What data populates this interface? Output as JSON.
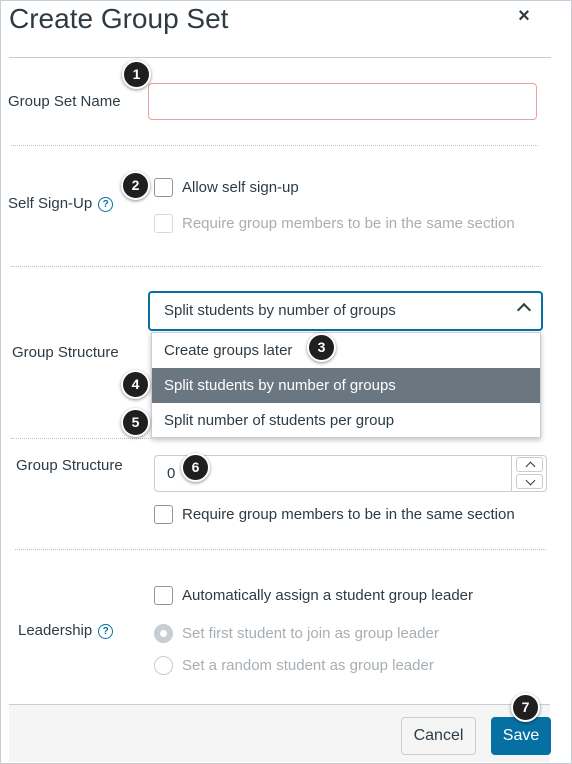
{
  "dialog": {
    "title": "Create Group Set",
    "close_icon": "close-icon",
    "close_glyph": "×"
  },
  "group_set_name": {
    "label": "Group Set Name",
    "value": "",
    "placeholder": ""
  },
  "self_signup": {
    "label": "Self Sign-Up",
    "help_glyph": "?",
    "allow_label": "Allow self sign-up",
    "allow_checked": false,
    "require_section_label": "Require group members to be in the same section",
    "require_section_disabled": true
  },
  "group_structure": {
    "label": "Group Structure",
    "selected": "Split students by number of groups",
    "options": [
      "Create groups later",
      "Split students by number of groups",
      "Split number of students per group"
    ],
    "selected_index": 1
  },
  "group_count": {
    "label": "Group Structure",
    "value": "0",
    "require_section_label": "Require group members to be in the same section"
  },
  "leadership": {
    "label": "Leadership",
    "help_glyph": "?",
    "auto_assign_label": "Automatically assign a student group leader",
    "options": [
      "Set first student to join as group leader",
      "Set a random student as group leader"
    ],
    "selected_index": 0
  },
  "footer": {
    "cancel_label": "Cancel",
    "save_label": "Save"
  },
  "callouts": [
    "1",
    "2",
    "3",
    "4",
    "5",
    "6",
    "7"
  ],
  "colors": {
    "accent": "#0770a3",
    "text": "#2d3b45",
    "selected_option": "#6b7780",
    "callout": "#1f1f1f"
  }
}
